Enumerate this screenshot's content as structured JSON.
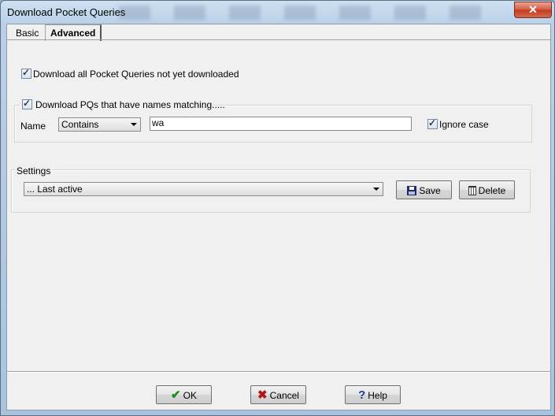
{
  "window": {
    "title": "Download Pocket Queries",
    "close_label": "✕"
  },
  "tabs": [
    {
      "label": "Basic"
    },
    {
      "label": "Advanced"
    }
  ],
  "advanced": {
    "download_all": {
      "label": "Download all Pocket Queries not yet downloaded",
      "checked": true
    },
    "match_names": {
      "label": "Download PQs that have names matching.....",
      "checked": true
    },
    "name_label": "Name",
    "match_mode": {
      "value": "Contains"
    },
    "name_pattern": {
      "value": "wa"
    },
    "ignore_case": {
      "label": "Ignore case",
      "checked": true
    }
  },
  "settings": {
    "legend": "Settings",
    "selected": "... Last active",
    "save_label": "Save",
    "delete_label": "Delete"
  },
  "footer": {
    "ok_label": "OK",
    "cancel_label": "Cancel",
    "help_label": "Help"
  },
  "colors": {
    "ok_check": "#1f8a1f",
    "cancel_x": "#b01818",
    "help_q": "#1b3f8f"
  }
}
